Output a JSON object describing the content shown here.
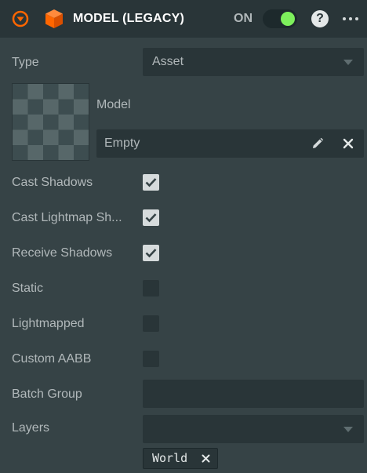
{
  "header": {
    "title": "MODEL (LEGACY)",
    "enabled_label": "ON",
    "enabled": true,
    "help_label": "?",
    "icons": {
      "collapse": "collapse-arrow-icon",
      "component": "cube-icon",
      "more": "more-options-icon"
    },
    "colors": {
      "accent": "#ff6600",
      "toggle_on": "#7df05c"
    }
  },
  "fields": {
    "type": {
      "label": "Type",
      "value": "Asset"
    },
    "model": {
      "label": "Model",
      "value": "Empty"
    },
    "cast_shadows": {
      "label": "Cast Shadows",
      "checked": true
    },
    "cast_lightmap_shadows": {
      "label": "Cast Lightmap Sh...",
      "checked": true
    },
    "receive_shadows": {
      "label": "Receive Shadows",
      "checked": true
    },
    "static": {
      "label": "Static",
      "checked": false
    },
    "lightmapped": {
      "label": "Lightmapped",
      "checked": false
    },
    "custom_aabb": {
      "label": "Custom AABB",
      "checked": false
    },
    "batch_group": {
      "label": "Batch Group",
      "value": ""
    },
    "layers": {
      "label": "Layers",
      "value": "",
      "tags": [
        "World"
      ]
    }
  }
}
